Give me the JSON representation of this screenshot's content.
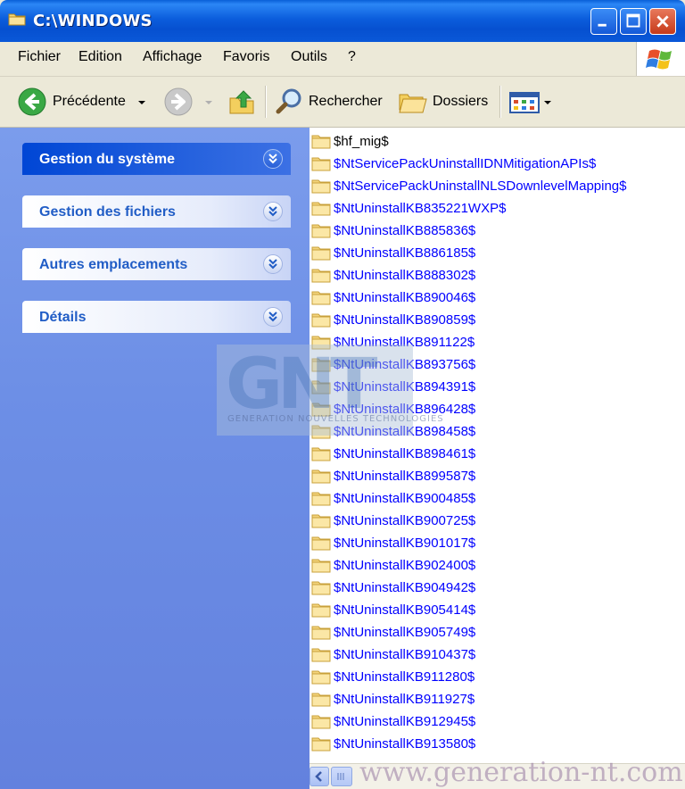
{
  "window": {
    "title": "C:\\WINDOWS"
  },
  "menu": {
    "items": [
      "Fichier",
      "Edition",
      "Affichage",
      "Favoris",
      "Outils",
      "?"
    ]
  },
  "toolbar": {
    "back_label": "Précédente",
    "search_label": "Rechercher",
    "folders_label": "Dossiers"
  },
  "taskpane": {
    "panels": [
      {
        "label": "Gestion du système",
        "active": true
      },
      {
        "label": "Gestion des fichiers",
        "active": false
      },
      {
        "label": "Autres emplacements",
        "active": false
      },
      {
        "label": "Détails",
        "active": false
      }
    ]
  },
  "watermark": {
    "letters": "GNT",
    "tagline": "GENERATION NOUVELLES TECHNOLOGIES",
    "url": "www.generation-nt.com"
  },
  "files": [
    {
      "name": "$hf_mig$",
      "compressed": false
    },
    {
      "name": "$NtServicePackUninstallIDNMitigationAPIs$",
      "compressed": true
    },
    {
      "name": "$NtServicePackUninstallNLSDownlevelMapping$",
      "compressed": true
    },
    {
      "name": "$NtUninstallKB835221WXP$",
      "compressed": true
    },
    {
      "name": "$NtUninstallKB885836$",
      "compressed": true
    },
    {
      "name": "$NtUninstallKB886185$",
      "compressed": true
    },
    {
      "name": "$NtUninstallKB888302$",
      "compressed": true
    },
    {
      "name": "$NtUninstallKB890046$",
      "compressed": true
    },
    {
      "name": "$NtUninstallKB890859$",
      "compressed": true
    },
    {
      "name": "$NtUninstallKB891122$",
      "compressed": true
    },
    {
      "name": "$NtUninstallKB893756$",
      "compressed": true
    },
    {
      "name": "$NtUninstallKB894391$",
      "compressed": true
    },
    {
      "name": "$NtUninstallKB896428$",
      "compressed": true
    },
    {
      "name": "$NtUninstallKB898458$",
      "compressed": true
    },
    {
      "name": "$NtUninstallKB898461$",
      "compressed": true
    },
    {
      "name": "$NtUninstallKB899587$",
      "compressed": true
    },
    {
      "name": "$NtUninstallKB900485$",
      "compressed": true
    },
    {
      "name": "$NtUninstallKB900725$",
      "compressed": true
    },
    {
      "name": "$NtUninstallKB901017$",
      "compressed": true
    },
    {
      "name": "$NtUninstallKB902400$",
      "compressed": true
    },
    {
      "name": "$NtUninstallKB904942$",
      "compressed": true
    },
    {
      "name": "$NtUninstallKB905414$",
      "compressed": true
    },
    {
      "name": "$NtUninstallKB905749$",
      "compressed": true
    },
    {
      "name": "$NtUninstallKB910437$",
      "compressed": true
    },
    {
      "name": "$NtUninstallKB911280$",
      "compressed": true
    },
    {
      "name": "$NtUninstallKB911927$",
      "compressed": true
    },
    {
      "name": "$NtUninstallKB912945$",
      "compressed": true
    },
    {
      "name": "$NtUninstallKB913580$",
      "compressed": true
    }
  ],
  "colors": {
    "compressed_text": "#0000ff",
    "titlebar": "#0a5fd8",
    "taskpane": "#6d8fe6"
  }
}
